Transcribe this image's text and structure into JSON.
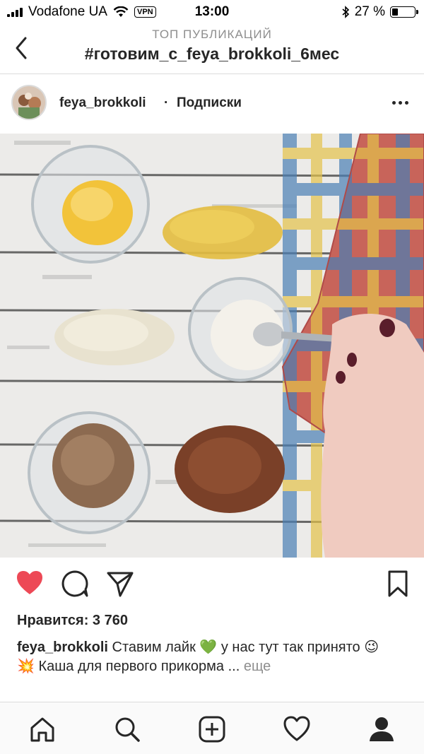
{
  "status_bar": {
    "carrier": "Vodafone UA",
    "vpn": "VPN",
    "time": "13:00",
    "battery_text": "27 %",
    "battery_level": 0.27
  },
  "header": {
    "subtitle": "ТОП ПУБЛИКАЦИЙ",
    "title": "#готовим_с_feya_brokkoli_6мес",
    "back_icon": "chevron-left-icon"
  },
  "post": {
    "username": "feya_brokkoli",
    "separator": "·",
    "follow_label": "Подписки",
    "more_icon": "ellipsis-icon",
    "likes_text": "Нравится: 3 760",
    "caption_user": "feya_brokkoli",
    "caption_line1": "Ставим лайк 💚 у нас тут так принято 😉",
    "caption_line2": "💥 Каша для первого прикорма ...",
    "more_label": "еще",
    "liked": true,
    "like_color": "#ed4956"
  },
  "tabbar": {
    "icons": [
      "home-icon",
      "search-icon",
      "add-post-icon",
      "activity-heart-icon",
      "profile-icon"
    ]
  }
}
